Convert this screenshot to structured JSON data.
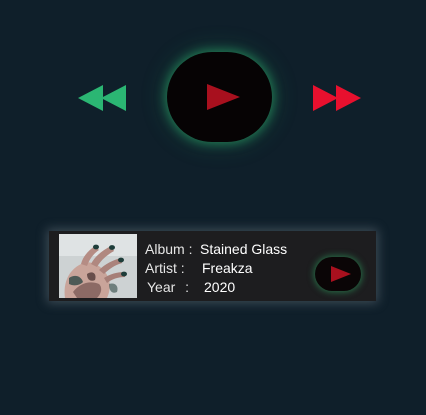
{
  "player": {
    "controls": {
      "rewind_icon": "rewind-icon",
      "play_icon": "play-icon",
      "forward_icon": "fast-forward-icon"
    }
  },
  "track": {
    "album_label": "Album :",
    "album": "Stained Glass",
    "artist_label": "Artist :",
    "artist": "Freakza",
    "year_label": "Year :",
    "year": "2020"
  },
  "colors": {
    "background": "#0f1f2a",
    "accent_green": "#2bb673",
    "accent_red": "#e8102e",
    "play_triangle": "#a8101e",
    "card_background": "#1d1d1f"
  }
}
